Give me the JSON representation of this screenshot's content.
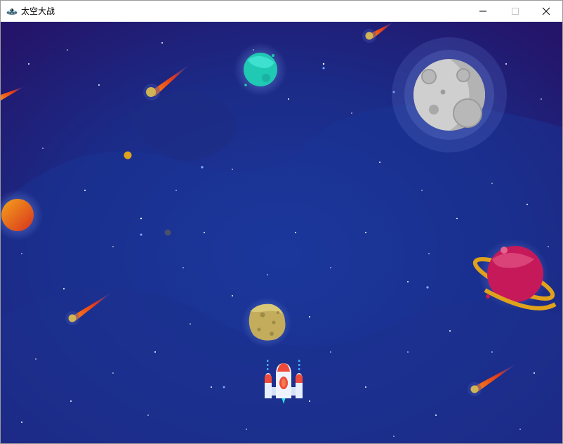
{
  "window": {
    "title": "太空大战",
    "app_icon": "ufo-icon",
    "controls": [
      "minimize-icon",
      "maximize-icon",
      "close-icon"
    ]
  },
  "scene": {
    "background_colors": [
      "#1a1d6e",
      "#1c3a9e",
      "#2a1670"
    ],
    "sprites": [
      "player-spaceship",
      "asteroid",
      "moon",
      "teal-planet",
      "orange-planet",
      "ringed-planet",
      "comet"
    ]
  }
}
